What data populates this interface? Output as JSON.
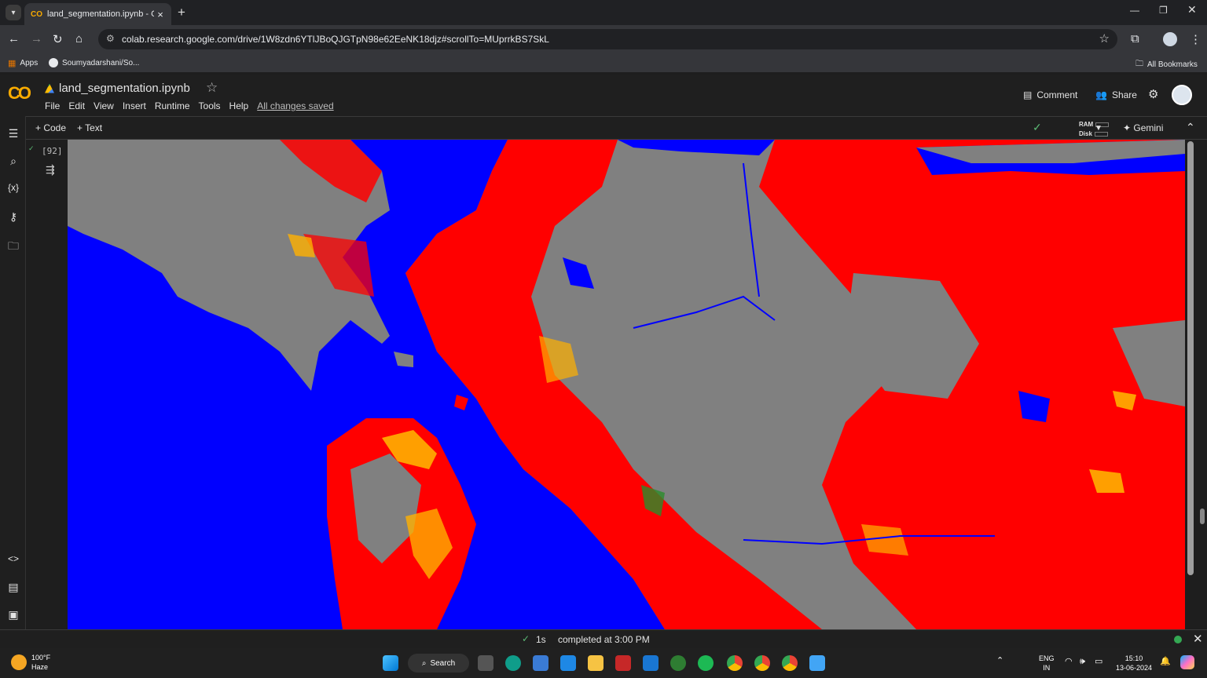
{
  "browser": {
    "tab_title": "land_segmentation.ipynb - Cola",
    "tab_favicon": "CO",
    "url": "colab.research.google.com/drive/1W8zdn6YTlJBoQJGTpN98e62EeNK18djz#scrollTo=MUprrkBS7SkL",
    "bookmarks": [
      {
        "label": "Apps",
        "icon": "apps-grid-icon"
      },
      {
        "label": "Soumyadarshani/So...",
        "icon": "github-icon"
      }
    ],
    "all_bookmarks_label": "All Bookmarks"
  },
  "colab": {
    "logo": "CO",
    "notebook_title": "land_segmentation.ipynb",
    "menus": [
      "File",
      "Edit",
      "View",
      "Insert",
      "Runtime",
      "Tools",
      "Help"
    ],
    "save_status": "All changes saved",
    "comment_label": "Comment",
    "share_label": "Share",
    "add_code_label": "Code",
    "add_text_label": "Text",
    "ram_label": "RAM",
    "disk_label": "Disk",
    "gemini_label": "Gemini"
  },
  "cell": {
    "execution_count": "[92]",
    "output_image": {
      "type": "land segmentation map",
      "class_colors": {
        "water": "#0000ff",
        "land": "#808080",
        "urban_dense": "#ff0000",
        "mixed": "#ffb000",
        "vegetation": "#2a8c2a"
      }
    }
  },
  "status": {
    "duration": "1s",
    "message": "completed at 3:00 PM"
  },
  "taskbar": {
    "temperature": "100°F",
    "weather": "Haze",
    "search_label": "Search",
    "language": "ENG",
    "region": "IN",
    "time": "15:10",
    "date": "13-06-2024"
  }
}
